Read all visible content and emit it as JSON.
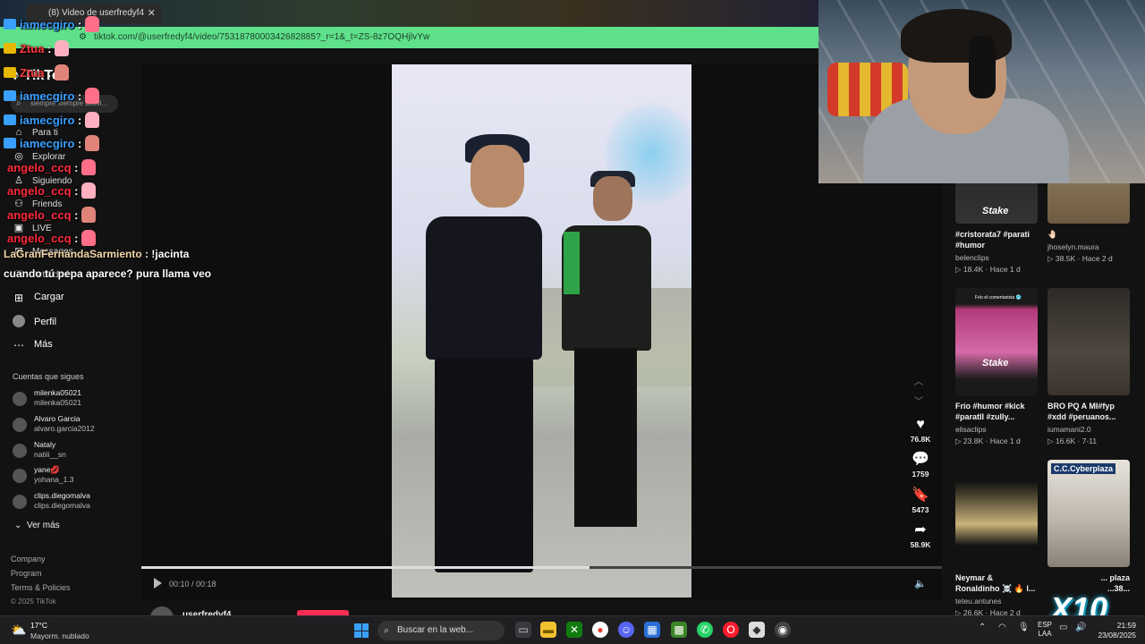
{
  "browser": {
    "tab_title": "(8) Video de userfredyf4",
    "url": "tiktok.com/@userfredyf4/video/7531878000342682885?_r=1&_t=ZS-8z7OQHjlvYw"
  },
  "tiktok": {
    "logo": "TikTok",
    "search_placeholder": "siempre siempre bolivi...",
    "nav": [
      "Para ti",
      "Explorar",
      "Siguiendo",
      "Friends",
      "LIVE",
      "Messages",
      "Actividad"
    ],
    "nav_main": {
      "cargar": "Cargar",
      "perfil": "Perfil",
      "mas": "Más"
    },
    "following_header": "Cuentas que sigues",
    "following": [
      {
        "name": "milenka05021",
        "user": "milenka05021"
      },
      {
        "name": "Alvaro Garcia",
        "user": "alvaro.garcia2012"
      },
      {
        "name": "Nataly",
        "user": "natiii__sn"
      },
      {
        "name": "yane💋",
        "user": "yohana_1.3"
      },
      {
        "name": "clips.diegomalva",
        "user": "clips.diegomalva"
      }
    ],
    "ver_mas": "Ver más",
    "footer": [
      "Company",
      "Program",
      "Terms & Policies",
      "© 2025 TikTok"
    ],
    "player": {
      "time": "00:10 / 00:18",
      "progress": 0.56,
      "author": "userfredyf4"
    },
    "actions": [
      {
        "icon": "heart-icon",
        "glyph": "♥",
        "count": "76.8K"
      },
      {
        "icon": "comment-icon",
        "glyph": "💬",
        "count": "1759"
      },
      {
        "icon": "bookmark-icon",
        "glyph": "🔖",
        "count": "5473"
      },
      {
        "icon": "share-icon",
        "glyph": "➦",
        "count": "58.9K"
      }
    ],
    "recommended": [
      {
        "title": "#cristorata7 #parati",
        "title2": "#humor",
        "user": "belenclips",
        "views": "18.4K",
        "time": "Hace 1 d",
        "overlay": "Stake"
      },
      {
        "title": "🤚🏻",
        "title2": "",
        "user": "jhoselyn.maura",
        "views": "38.5K",
        "time": "Hace 2 d",
        "overlay": ""
      },
      {
        "title": "Frío #humor #kick",
        "title2": "#paratII #zully...",
        "user": "elisaclips",
        "views": "23.8K",
        "time": "Hace 1 d",
        "overlay": "Stake",
        "caption": "Frío el comentarista 🥶"
      },
      {
        "title": "BRO PQ A MI#fyp",
        "title2": "#xdd #peruanos...",
        "user": "iumamani2.0",
        "views": "16.6K",
        "time": "7-11",
        "overlay": ""
      },
      {
        "title": "Neymar &",
        "title2": "Ronaldinho ☠️ 🔥 l...",
        "user": "teteu.antunes",
        "views": "26.6K",
        "time": "Hace 2 d",
        "overlay": ""
      },
      {
        "title": "... plaza",
        "title2": "...38...",
        "user": "",
        "views": "",
        "time": "",
        "overlay": "C.C.Cyberplaza"
      }
    ]
  },
  "chat": [
    {
      "user": "iamecgiro",
      "color": "#3aa0ff",
      "badge": "#3aa0ff"
    },
    {
      "user": "Ztua",
      "color": "#ff3a3a",
      "badge": "#e6b800"
    },
    {
      "user": "Ztua",
      "color": "#ff3a3a",
      "badge": "#e6b800"
    },
    {
      "user": "iamecgiro",
      "color": "#3aa0ff",
      "badge": "#3aa0ff"
    },
    {
      "user": "iamecgiro",
      "color": "#3aa0ff",
      "badge": "#3aa0ff"
    },
    {
      "user": "iamecgiro",
      "color": "#3aa0ff",
      "badge": "#3aa0ff"
    },
    {
      "user": "angelo_ccq",
      "color": "#ff2a3a",
      "badge": ""
    },
    {
      "user": "angelo_ccq",
      "color": "#ff2a3a",
      "badge": ""
    },
    {
      "user": "angelo_ccq",
      "color": "#ff2a3a",
      "badge": ""
    },
    {
      "user": "angelo_ccq",
      "color": "#ff2a3a",
      "badge": ""
    }
  ],
  "chat_last": {
    "user": "LaGranFernandaSarmiento",
    "user_color": "#f5d9a8",
    "line1": ": !jacinta",
    "line2": "cuando tú pepa aparece? pura llama veo"
  },
  "multiplier": "X10",
  "taskbar": {
    "weather_temp": "17°C",
    "weather_desc": "Mayorm. nublado",
    "search": "Buscar en la web...",
    "lang1": "ESP",
    "lang2": "LAA",
    "time": "21:59",
    "date": "23/08/2025"
  }
}
